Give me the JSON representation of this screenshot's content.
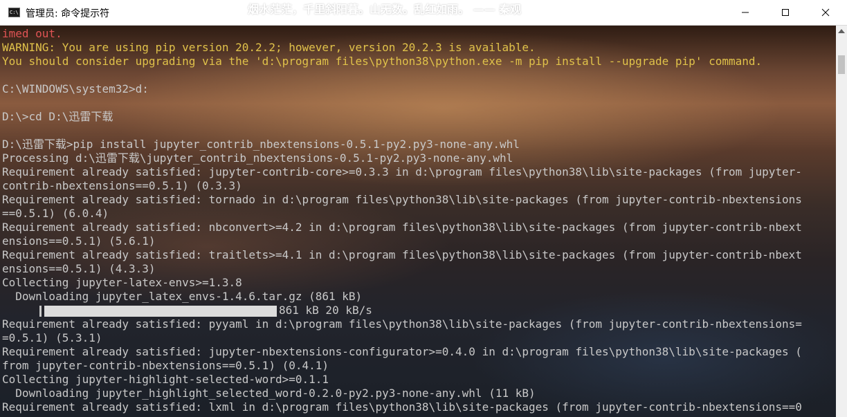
{
  "window": {
    "title": "管理员: 命令提示符",
    "poem_overlay": "烟水茫茫，千里斜阳暮。山无数。乱红如雨。 —— 秦观",
    "icon_text": "C:\\",
    "buttons": {
      "minimize": "minimize-icon",
      "maximize": "maximize-icon",
      "close": "close-icon"
    }
  },
  "colors": {
    "error_text": "#e05454",
    "warning_text": "#e0c24a",
    "normal_text": "#c9c9c9"
  },
  "console": {
    "lines": [
      {
        "text": "imed out.",
        "style": "red"
      },
      {
        "text": "WARNING: You are using pip version 20.2.2; however, version 20.2.3 is available.",
        "style": "yellow"
      },
      {
        "text": "You should consider upgrading via the 'd:\\program files\\python38\\python.exe -m pip install --upgrade pip' command.",
        "style": "yellow"
      },
      {
        "text": "",
        "style": "normal"
      },
      {
        "text": "C:\\WINDOWS\\system32>d:",
        "style": "normal"
      },
      {
        "text": "",
        "style": "normal"
      },
      {
        "text": "D:\\>cd D:\\迅雷下载",
        "style": "normal"
      },
      {
        "text": "",
        "style": "normal"
      },
      {
        "text": "D:\\迅雷下载>pip install jupyter_contrib_nbextensions-0.5.1-py2.py3-none-any.whl",
        "style": "normal"
      },
      {
        "text": "Processing d:\\迅雷下载\\jupyter_contrib_nbextensions-0.5.1-py2.py3-none-any.whl",
        "style": "normal"
      },
      {
        "text": "Requirement already satisfied: jupyter-contrib-core>=0.3.3 in d:\\program files\\python38\\lib\\site-packages (from jupyter-",
        "style": "normal"
      },
      {
        "text": "contrib-nbextensions==0.5.1) (0.3.3)",
        "style": "normal"
      },
      {
        "text": "Requirement already satisfied: tornado in d:\\program files\\python38\\lib\\site-packages (from jupyter-contrib-nbextensions",
        "style": "normal"
      },
      {
        "text": "==0.5.1) (6.0.4)",
        "style": "normal"
      },
      {
        "text": "Requirement already satisfied: nbconvert>=4.2 in d:\\program files\\python38\\lib\\site-packages (from jupyter-contrib-nbext",
        "style": "normal"
      },
      {
        "text": "ensions==0.5.1) (5.6.1)",
        "style": "normal"
      },
      {
        "text": "Requirement already satisfied: traitlets>=4.1 in d:\\program files\\python38\\lib\\site-packages (from jupyter-contrib-nbext",
        "style": "normal"
      },
      {
        "text": "ensions==0.5.1) (4.3.3)",
        "style": "normal"
      },
      {
        "text": "Collecting jupyter-latex-envs>=1.3.8",
        "style": "normal"
      },
      {
        "text": "  Downloading jupyter_latex_envs-1.4.6.tar.gz (861 kB)",
        "style": "normal"
      },
      {
        "text": "",
        "style": "progress"
      },
      {
        "text": "Requirement already satisfied: pyyaml in d:\\program files\\python38\\lib\\site-packages (from jupyter-contrib-nbextensions=",
        "style": "normal"
      },
      {
        "text": "=0.5.1) (5.3.1)",
        "style": "normal"
      },
      {
        "text": "Requirement already satisfied: jupyter-nbextensions-configurator>=0.4.0 in d:\\program files\\python38\\lib\\site-packages (",
        "style": "normal"
      },
      {
        "text": "from jupyter-contrib-nbextensions==0.5.1) (0.4.1)",
        "style": "normal"
      },
      {
        "text": "Collecting jupyter-highlight-selected-word>=0.1.1",
        "style": "normal"
      },
      {
        "text": "  Downloading jupyter_highlight_selected_word-0.2.0-py2.py3-none-any.whl (11 kB)",
        "style": "normal"
      },
      {
        "text": "Requirement already satisfied: lxml in d:\\program files\\python38\\lib\\site-packages (from jupyter-contrib-nbextensions==0",
        "style": "normal"
      }
    ],
    "progress": {
      "fraction": 1.0,
      "text": "861 kB 20 kB/s"
    }
  }
}
